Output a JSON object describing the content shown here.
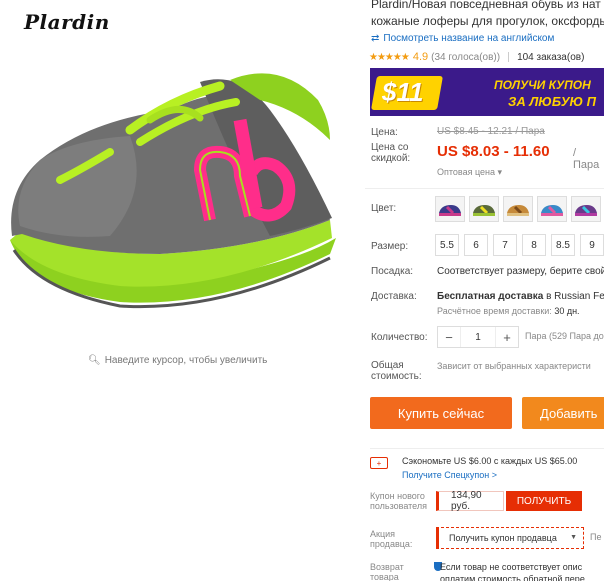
{
  "brand": {
    "logo_text": "Plardin"
  },
  "gallery": {
    "zoom_hint": "Наведите курсор, чтобы увеличить"
  },
  "product": {
    "title_line1": "Plardin/Новая повседневная обувь из нат",
    "title_line2": "кожаные лоферы для прогулок, оксфорды",
    "translate_link": "Посмотреть название на английском",
    "rating": {
      "score": "4.9",
      "votes": "(34 голоса(ов))",
      "orders": "104 заказа(ов)",
      "stars": "★★★★★"
    },
    "banner": {
      "amount": "$11",
      "line1": "ПОЛУЧИ КУПОН",
      "line2": "ЗА ЛЮБУЮ П"
    },
    "price": {
      "label": "Цена:",
      "old": "US $8.45 - 12.21 / Пара",
      "discount_label_1": "Цена со",
      "discount_label_2": "скидкой:",
      "current": "US $8.03 - 11.60",
      "unit": "/ Пара",
      "wholesale": "Оптовая цена ▾"
    },
    "color": {
      "label": "Цвет:",
      "swatches": [
        "#c83a8a",
        "#9ac234",
        "#c68a3a",
        "#3a8ac8",
        "#b03aa0"
      ]
    },
    "size": {
      "label": "Размер:",
      "options": [
        "5.5",
        "6",
        "7",
        "8",
        "8.5",
        "9"
      ]
    },
    "fit": {
      "label": "Посадка:",
      "value": "Соответствует размеру, берите свой"
    },
    "shipping": {
      "label": "Доставка:",
      "value_bold": "Бесплатная доставка",
      "value_rest": " в Russian Fed",
      "time_prefix": "Расчётное время доставки:",
      "time_value": "30 дн."
    },
    "quantity": {
      "label": "Количество:",
      "value": "1",
      "minus": "−",
      "plus": "+",
      "available": "Пара (529 Пара до"
    },
    "total": {
      "label_1": "Общая",
      "label_2": "стоимость:",
      "value": "Зависит от выбранных характеристи"
    },
    "actions": {
      "buy_now": "Купить сейчас",
      "add_to_cart": "Добавить"
    },
    "coupons": {
      "save_text": "Сэкономьте US $6.00 с каждых US $65.00",
      "save_link": "Получите Спецкупон >",
      "new_user_label_1": "Купон нового",
      "new_user_label_2": "пользователя",
      "new_user_value": "134,90 руб.",
      "get_button": "ПОЛУЧИТЬ",
      "promo_label_1": "Акция",
      "promo_label_2": "продавца:",
      "promo_select": "Получить купон продавца",
      "promo_extra": "Пе",
      "return_label_1": "Возврат",
      "return_label_2": "товара",
      "return_line1": "Если товар не соответствует опис",
      "return_line2": "оплатим стоимость обратной пере"
    }
  },
  "colors": {
    "accent": "#e62e04",
    "buy": "#f26a1d",
    "cart": "#f2891d",
    "link": "#1a6ec2",
    "banner_bg": "#3b1a8a",
    "banner_text": "#ffd200"
  }
}
